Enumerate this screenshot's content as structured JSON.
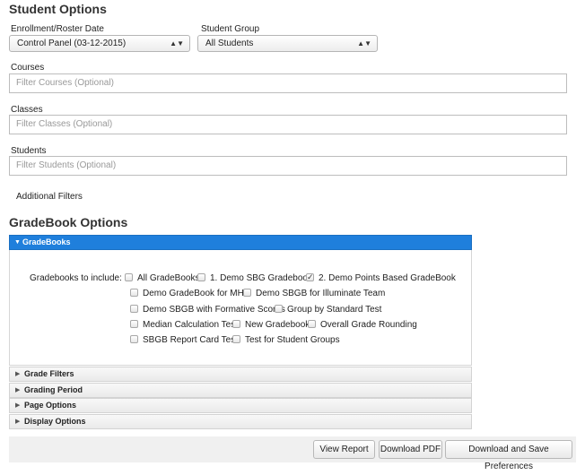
{
  "student_options": {
    "title": "Student Options",
    "enrollment_label": "Enrollment/Roster Date",
    "enrollment_value": "Control Panel (03-12-2015)",
    "group_label": "Student Group",
    "group_value": "All Students",
    "courses_label": "Courses",
    "courses_placeholder": "Filter Courses (Optional)",
    "classes_label": "Classes",
    "classes_placeholder": "Filter Classes (Optional)",
    "students_label": "Students",
    "students_placeholder": "Filter Students (Optional)",
    "additional_filters": "Additional Filters"
  },
  "gradebook_options": {
    "title": "GradeBook Options",
    "active_section": "GradeBooks",
    "include_label": "Gradebooks to include:",
    "gradebooks": [
      {
        "label": "All GradeBooks",
        "checked": false
      },
      {
        "label": "1. Demo SBG Gradebook",
        "checked": false
      },
      {
        "label": "2. Demo Points Based GradeBook",
        "checked": true
      },
      {
        "label": "Demo GradeBook for MHS",
        "checked": false
      },
      {
        "label": "Demo SBGB for Illuminate Team",
        "checked": false
      },
      {
        "label": "Demo SBGB with Formative Scores",
        "checked": false
      },
      {
        "label": "Group by Standard Test",
        "checked": false
      },
      {
        "label": "Median Calculation Test",
        "checked": false
      },
      {
        "label": "New Gradebook",
        "checked": false
      },
      {
        "label": "Overall Grade Rounding",
        "checked": false
      },
      {
        "label": "SBGB Report Card Test",
        "checked": false
      },
      {
        "label": "Test for Student Groups",
        "checked": false
      }
    ],
    "sections": [
      "Grade Filters",
      "Grading Period",
      "Page Options",
      "Display Options"
    ]
  },
  "footer": {
    "view_report": "View Report",
    "download_pdf": "Download PDF",
    "download_save": "Download and Save Preferences"
  }
}
